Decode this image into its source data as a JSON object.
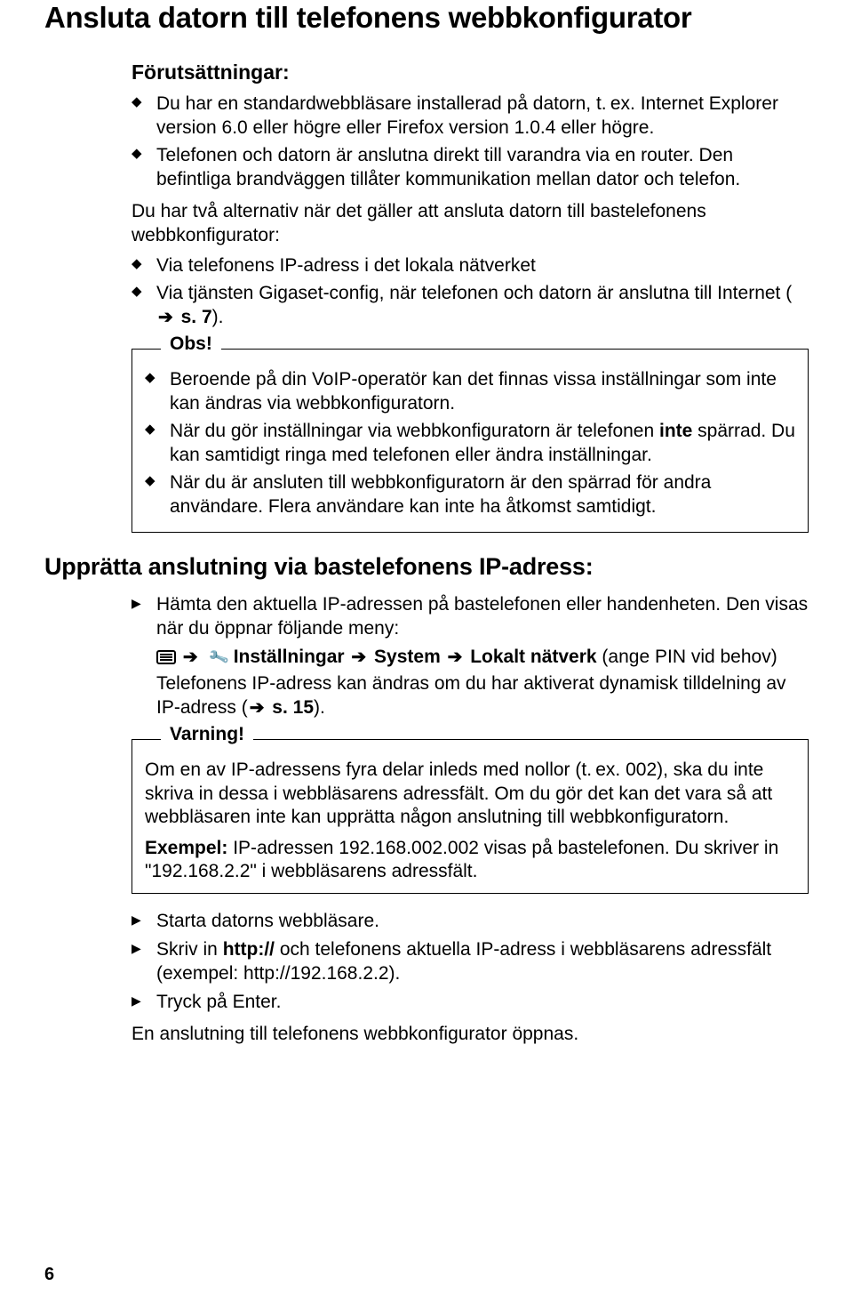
{
  "h1": "Ansluta datorn till telefonens webbkonfigurator",
  "prereq": {
    "heading": "Förutsättningar:",
    "items": [
      "Du har en standardwebbläsare installerad på datorn, t. ex. Internet Explorer version 6.0 eller högre eller Firefox version 1.0.4 eller högre.",
      "Telefonen och datorn är anslutna direkt till varandra via en router. Den befintliga brandväggen tillåter kommunikation mellan dator och telefon."
    ]
  },
  "altIntro": "Du har två alternativ när det gäller att ansluta datorn till bastelefonens webbkonfigurator:",
  "altItems": {
    "i0": "Via telefonens IP-adress i det lokala nätverket",
    "i1_pre": "Via tjänsten Gigaset-config, när telefonen och datorn är anslutna till Internet (",
    "i1_arrow": "➔",
    "i1_ref": " s. 7",
    "i1_post": ")."
  },
  "obs": {
    "title": "Obs!",
    "items": {
      "i0": "Beroende på din VoIP-operatör kan det finnas vissa inställningar som inte kan ändras via webbkonfiguratorn.",
      "i1_a": "När du gör inställningar via webbkonfiguratorn är telefonen ",
      "i1_b": "inte",
      "i1_c": " spärrad. Du kan samtidigt ringa med telefonen eller ändra inställningar.",
      "i2": "När du är ansluten till webbkonfiguratorn är den spärrad för andra användare. Flera användare kan inte ha åtkomst samtidigt."
    }
  },
  "h2": "Upprätta anslutning via bastelefonens IP-adress:",
  "ip": {
    "step1": "Hämta den aktuella IP-adressen på bastelefonen eller handenheten. Den visas när du öppnar följande meny:",
    "menu": {
      "arrow": "➔",
      "settings": "Inställningar",
      "system": "System",
      "local": "Lokalt nätverk",
      "pin": " (ange PIN vid behov)"
    },
    "dyn_a": "Telefonens IP-adress kan ändras om du har aktiverat dynamisk tilldelning av IP-adress (",
    "dyn_arrow": "➔",
    "dyn_ref": " s. 15",
    "dyn_b": ")."
  },
  "varning": {
    "title": "Varning!",
    "p1": "Om en av IP-adressens fyra delar inleds med nollor (t. ex. 002), ska du inte skriva in dessa i webbläsarens adressfält. Om du gör det kan det vara så att webbläsaren inte kan upprätta någon anslutning till webbkonfiguratorn.",
    "ex_label": "Exempel:",
    "ex_text": " IP-adressen 192.168.002.002 visas på bastelefonen. Du skriver in \"192.168.2.2\" i webbläsarens adressfält."
  },
  "steps2": {
    "s1": "Starta datorns webbläsare.",
    "s2_a": "Skriv in ",
    "s2_b": "http://",
    "s2_c": " och telefonens aktuella IP-adress i webbläsarens adressfält (exempel: http://192.168.2.2).",
    "s3": "Tryck på Enter."
  },
  "final": "En anslutning till telefonens webbkonfigurator öppnas.",
  "pageNum": "6"
}
